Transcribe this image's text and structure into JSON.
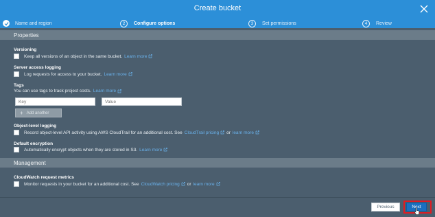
{
  "dialog": {
    "title": "Create bucket",
    "close_icon": "close-icon"
  },
  "steps": [
    {
      "marker": "",
      "label": "Name and region",
      "state": "done"
    },
    {
      "marker": "2",
      "label": "Configure options",
      "state": "active"
    },
    {
      "marker": "3",
      "label": "Set permissions",
      "state": "pending"
    },
    {
      "marker": "4",
      "label": "Review",
      "state": "pending"
    }
  ],
  "sections": {
    "properties": "Properties",
    "management": "Management"
  },
  "versioning": {
    "label": "Versioning",
    "text": "Keep all versions of an object in the same bucket.",
    "link": "Learn more"
  },
  "access_logging": {
    "label": "Server access logging",
    "text": "Log requests for access to your bucket.",
    "link": "Learn more"
  },
  "tags": {
    "label": "Tags",
    "text": "You can use tags to track project costs.",
    "link": "Learn more",
    "key_placeholder": "Key",
    "value_placeholder": "Value",
    "add_button": "Add another"
  },
  "object_logging": {
    "label": "Object-level logging",
    "text": "Record object-level API activity using AWS CloudTrail for an additional cost. See",
    "pricing_link": "CloudTrail pricing",
    "or": "or",
    "link": "learn more"
  },
  "encryption": {
    "label": "Default encryption",
    "text": "Automatically encrypt objects when they are stored in S3.",
    "link": "Learn more"
  },
  "cloudwatch": {
    "label": "CloudWatch request metrics",
    "text": "Monitor requests in your bucket for an additional cost. See",
    "pricing_link": "CloudWatch pricing",
    "or": "or",
    "link": "learn more"
  },
  "footer": {
    "previous": "Previous",
    "next": "Next"
  },
  "colors": {
    "header": "#2c8fd8",
    "panel": "#4b5e6e",
    "section_bar": "#6b7c89",
    "link": "#6ab2ec",
    "next_button": "#1a6fc0",
    "highlight": "#e01b22"
  }
}
